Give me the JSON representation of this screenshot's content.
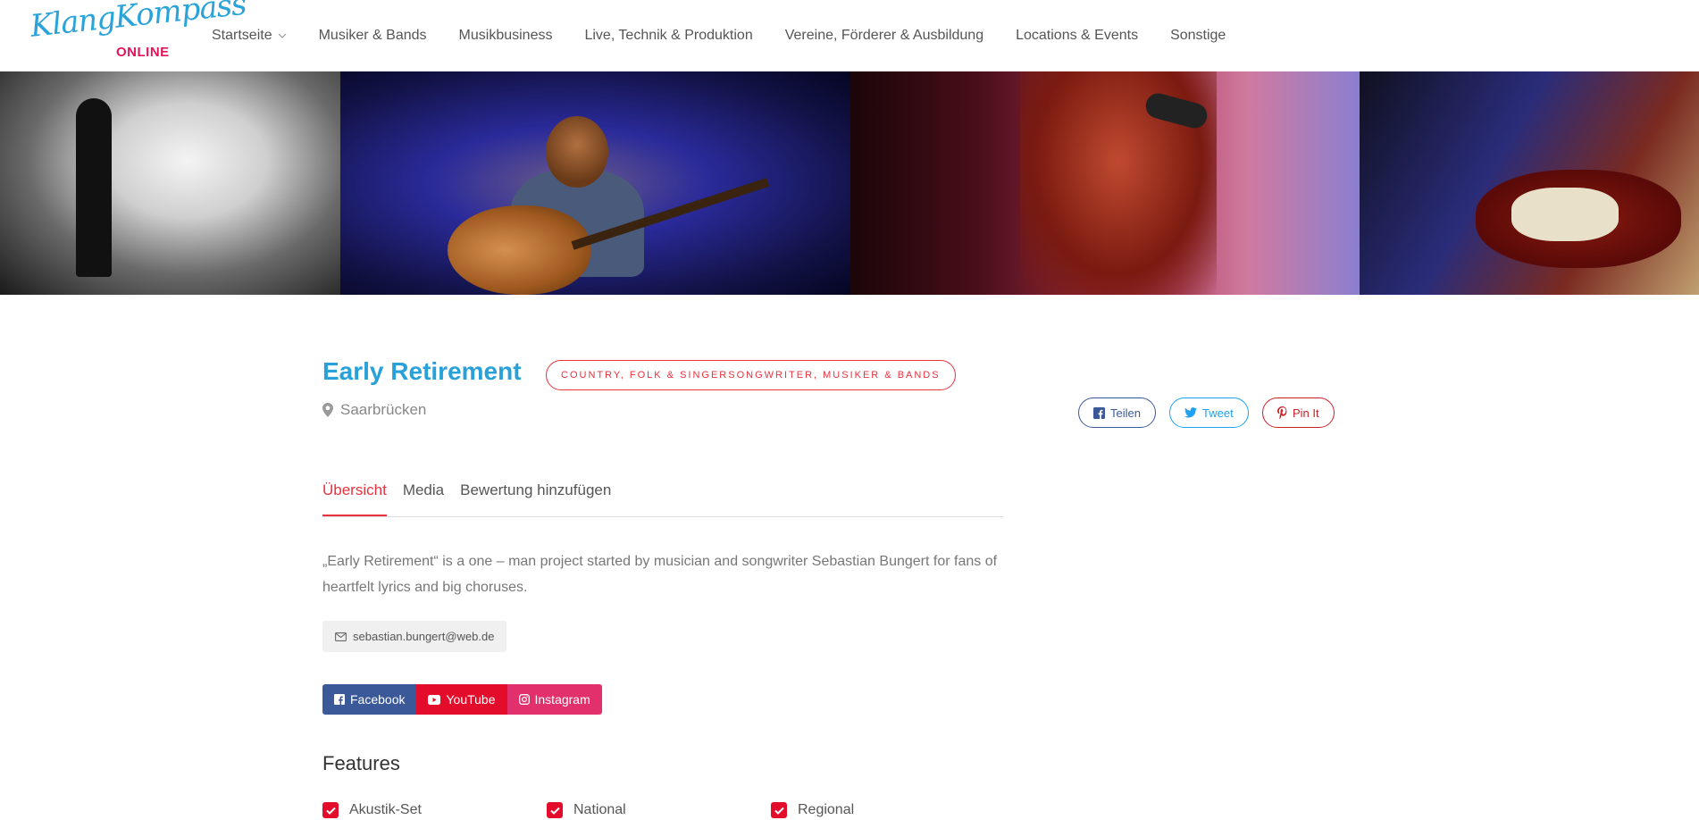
{
  "header": {
    "logo_script": "KlangKompass",
    "logo_online": "ONLINE",
    "nav": [
      {
        "label": "Startseite"
      },
      {
        "label": "Musiker & Bands"
      },
      {
        "label": "Musikbusiness"
      },
      {
        "label": "Live, Technik & Produktion"
      },
      {
        "label": "Vereine, Förderer & Ausbildung"
      },
      {
        "label": "Locations & Events"
      },
      {
        "label": "Sonstige"
      }
    ]
  },
  "listing": {
    "title": "Early Retirement",
    "categories": "COUNTRY, FOLK & SINGERSONGWRITER, MUSIKER & BANDS",
    "location": "Saarbrücken",
    "share": {
      "facebook": "Teilen",
      "twitter": "Tweet",
      "pinterest": "Pin It"
    },
    "tabs": [
      {
        "label": "Übersicht",
        "active": true
      },
      {
        "label": "Media"
      },
      {
        "label": "Bewertung hinzufügen"
      }
    ],
    "description": "„Early Retirement“ is a one – man project started by musician and songwriter Sebastian Bungert for fans of heartfelt lyrics and big choruses.",
    "email": "sebastian.bungert@web.de",
    "social": {
      "facebook": "Facebook",
      "youtube": "YouTube",
      "instagram": "Instagram"
    },
    "features_title": "Features",
    "features": [
      {
        "label": "Akustik-Set",
        "checked": true
      },
      {
        "label": "National",
        "checked": true
      },
      {
        "label": "Regional",
        "checked": true
      }
    ]
  },
  "colors": {
    "brand_blue": "#27a1d8",
    "accent_red": "#e9323e",
    "facebook": "#3b5998",
    "youtube": "#e40c2b",
    "instagram": "#e1306c"
  }
}
